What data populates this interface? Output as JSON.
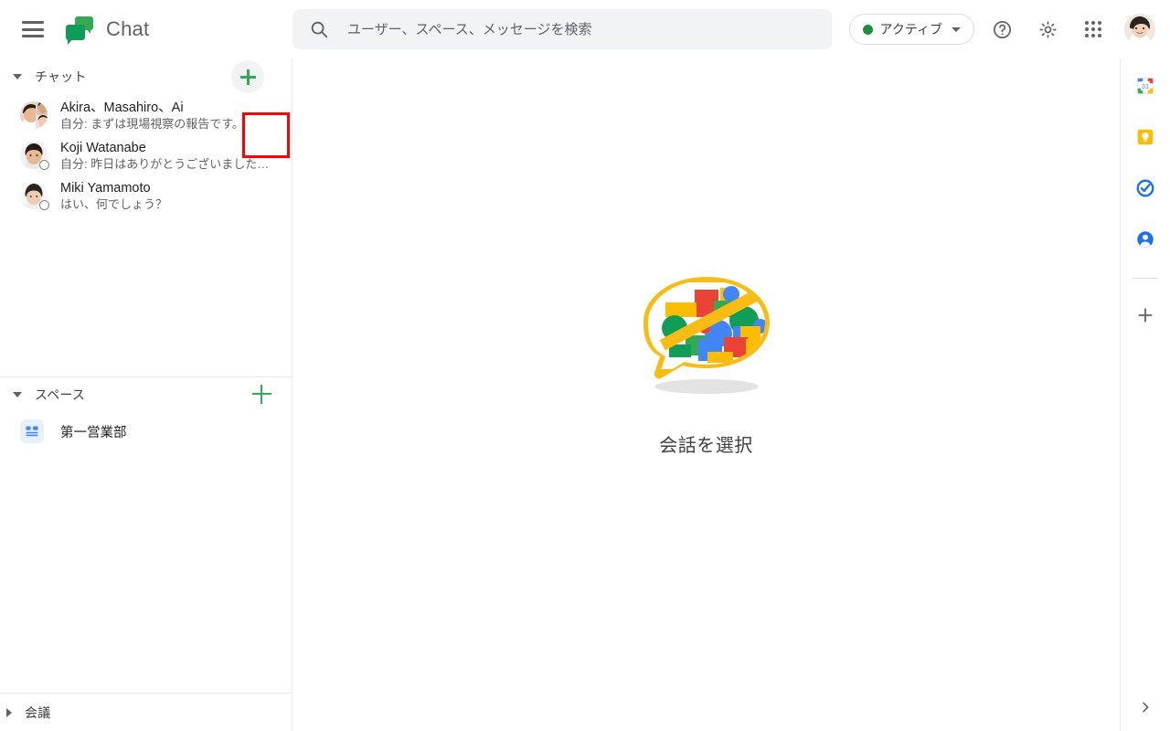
{
  "app": {
    "name": "Chat",
    "logo_icon": "google-chat-logo"
  },
  "topbar": {
    "menu_icon": "hamburger-menu-icon",
    "search": {
      "icon": "search-icon",
      "placeholder": "ユーザー、スペース、メッセージを検索",
      "value": ""
    },
    "status": {
      "label": "アクティブ",
      "dot_color": "#1e8e3e",
      "caret_icon": "chevron-down-icon"
    },
    "help_icon": "help-circle-icon",
    "settings_icon": "gear-icon",
    "apps_icon": "apps-grid-icon",
    "avatar": "account-avatar"
  },
  "sidebar": {
    "chat_section": {
      "title": "チャット",
      "collapse_icon": "triangle-down-icon",
      "add_button_icon": "plus-icon",
      "highlighted": true,
      "highlight_color": "#ff0000"
    },
    "chats": [
      {
        "name": "Akira、Masahiro、Ai",
        "snippet": "自分: まずは現場視察の報告です。",
        "avatar_type": "group",
        "presence": false
      },
      {
        "name": "Koji Watanabe",
        "snippet": "自分: 昨日はありがとうございました…",
        "avatar_type": "single",
        "presence": true
      },
      {
        "name": "Miki Yamamoto",
        "snippet": "はい、何でしょう？",
        "avatar_type": "single",
        "presence": true
      }
    ],
    "spaces_section": {
      "title": "スペース",
      "collapse_icon": "triangle-down-icon",
      "add_button_icon": "plus-icon"
    },
    "spaces": [
      {
        "name": "第一営業部",
        "icon": "space-grid-icon"
      }
    ],
    "meetings_section": {
      "title": "会議",
      "expand_icon": "triangle-right-icon"
    }
  },
  "main": {
    "illustration": "chat-bubble-blocks-illustration",
    "empty_text": "会話を選択"
  },
  "rail": {
    "items": [
      {
        "name": "calendar",
        "icon": "google-calendar-icon",
        "label": "31"
      },
      {
        "name": "keep",
        "icon": "google-keep-icon",
        "label": ""
      },
      {
        "name": "tasks",
        "icon": "google-tasks-icon",
        "label": ""
      },
      {
        "name": "contacts",
        "icon": "google-contacts-icon",
        "label": ""
      }
    ],
    "add_icon": "plus-icon",
    "expand_icon": "chevron-right-icon"
  },
  "colors": {
    "brand_green": "#0f9d58",
    "accent_green": "#34a853",
    "text_primary": "#202124",
    "text_secondary": "#5f6368",
    "surface_grey": "#f1f3f4",
    "border": "#e8eaed",
    "highlight_red": "#ff0000"
  }
}
